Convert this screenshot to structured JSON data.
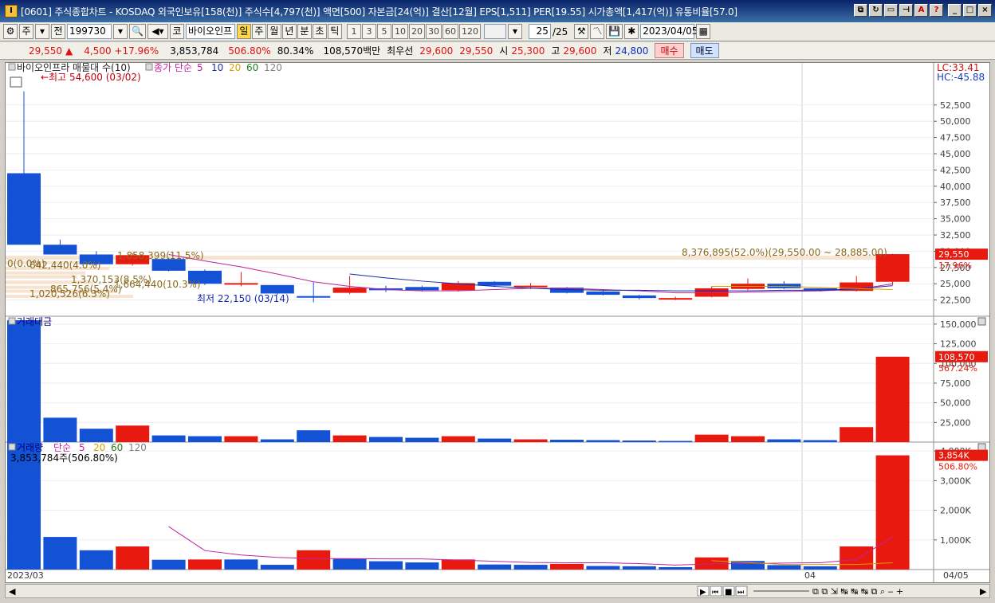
{
  "window": {
    "title": "[0601] 주식종합차트 - KOSDAQ 외국인보유[158(천)] 주식수[4,797(천)] 액면[500] 자본금[24(억)] 결산[12월] EPS[1,511] PER[19.55] 시가총액[1,417(억)] 유통비율[57.0]",
    "app_icon": "I"
  },
  "toolbar": {
    "period_type": "주",
    "prev_label": "전",
    "stock_code": "199730",
    "market_label": "코",
    "stock_name": "바이오인프",
    "intervals": [
      "일",
      "주",
      "월",
      "년",
      "분",
      "초",
      "틱"
    ],
    "selected_interval": "일",
    "minute_options": [
      "1",
      "3",
      "5",
      "10",
      "20",
      "30",
      "60",
      "120"
    ],
    "page_counter": "25",
    "page_total": "/25",
    "date": "2023/04/05"
  },
  "infobar": {
    "price": "29,550",
    "arrow": "▲",
    "change": "4,500 +17.96%",
    "volume": "3,853,784",
    "vol_ratio": "506.80%",
    "turnover": "80.34%",
    "amount": "108,570백만",
    "best_label": "최우선",
    "best_ask": "29,600",
    "best_bid": "29,550",
    "open_label": "시",
    "open": "25,300",
    "high_label": "고",
    "high": "29,600",
    "low_label": "저",
    "low": "24,800",
    "buy_label": "매수",
    "sell_label": "매도"
  },
  "chart_data": [
    {
      "type": "candlestick",
      "title": "바이오인프라 매물대 수(10)",
      "ma_label": "종가 단순",
      "ma_periods": [
        "5",
        "10",
        "20",
        "60",
        "120"
      ],
      "ylim": [
        20000,
        57500
      ],
      "yticks": [
        "52,500",
        "50,000",
        "47,500",
        "45,000",
        "42,500",
        "40,000",
        "37,500",
        "35,000",
        "32,500",
        "30,000",
        "27,500",
        "25,000",
        "22,500"
      ],
      "lc": "LC:33.41",
      "hc": "HC:-45.88",
      "current_price_label": "29,550",
      "current_pct_label": "17.96%",
      "high_annotation": "←최고 54,600 (03/02)",
      "low_annotation": "최저 22,150 (03/14)",
      "profile_annotation": "8,376,895(52.0%)(29,550.00 ~ 28,885.00)",
      "profile_labels": [
        "1,858,399(11.5%)",
        "1,370,153(8.5%)",
        "1,664,440(10.3%)",
        "865,756(5.4%)",
        "1,020,526(6.3%)",
        "0(0.0%)",
        "642,440(4.0%)"
      ],
      "candles": [
        {
          "o": 42000,
          "h": 54600,
          "l": 31000,
          "c": 31000
        },
        {
          "o": 31000,
          "h": 31800,
          "l": 29500,
          "c": 29500
        },
        {
          "o": 29500,
          "h": 30000,
          "l": 27800,
          "c": 28000
        },
        {
          "o": 28000,
          "h": 29700,
          "l": 27800,
          "c": 29400
        },
        {
          "o": 28800,
          "h": 29000,
          "l": 26900,
          "c": 27000
        },
        {
          "o": 27000,
          "h": 27200,
          "l": 24800,
          "c": 25000
        },
        {
          "o": 25000,
          "h": 26800,
          "l": 24600,
          "c": 25100
        },
        {
          "o": 24800,
          "h": 24800,
          "l": 23300,
          "c": 23500
        },
        {
          "o": 23100,
          "h": 25200,
          "l": 22150,
          "c": 23000
        },
        {
          "o": 23600,
          "h": 26200,
          "l": 23400,
          "c": 24400
        },
        {
          "o": 24300,
          "h": 24700,
          "l": 23700,
          "c": 24000
        },
        {
          "o": 24500,
          "h": 24700,
          "l": 23800,
          "c": 24000
        },
        {
          "o": 24000,
          "h": 25400,
          "l": 23800,
          "c": 25100
        },
        {
          "o": 25300,
          "h": 25400,
          "l": 24500,
          "c": 24700
        },
        {
          "o": 24500,
          "h": 25100,
          "l": 24200,
          "c": 24700
        },
        {
          "o": 24400,
          "h": 24500,
          "l": 23500,
          "c": 23600
        },
        {
          "o": 23800,
          "h": 24000,
          "l": 23200,
          "c": 23300
        },
        {
          "o": 23200,
          "h": 23300,
          "l": 22600,
          "c": 22800
        },
        {
          "o": 22800,
          "h": 23000,
          "l": 22500,
          "c": 22800
        },
        {
          "o": 23000,
          "h": 24600,
          "l": 22900,
          "c": 24300
        },
        {
          "o": 24200,
          "h": 25800,
          "l": 24000,
          "c": 25000
        },
        {
          "o": 25000,
          "h": 25400,
          "l": 24200,
          "c": 24300
        },
        {
          "o": 24300,
          "h": 24300,
          "l": 23800,
          "c": 24000
        },
        {
          "o": 23900,
          "h": 26200,
          "l": 23800,
          "c": 25200
        },
        {
          "o": 25300,
          "h": 29600,
          "l": 24800,
          "c": 29550
        }
      ],
      "ma5": [
        null,
        null,
        null,
        null,
        29500,
        28500,
        27600,
        26500,
        25300,
        24600,
        24100,
        23900,
        23900,
        24100,
        24300,
        24300,
        24100,
        23900,
        23600,
        23600,
        23700,
        23800,
        23900,
        24100,
        25000
      ],
      "ma10": [
        null,
        null,
        null,
        null,
        null,
        null,
        null,
        null,
        null,
        26500,
        25900,
        25400,
        25000,
        24600,
        24300,
        24100,
        24000,
        24000,
        23900,
        23900,
        23900,
        24000,
        24000,
        24200,
        24700
      ]
    },
    {
      "type": "bar",
      "title": "거래대금",
      "ylim": [
        0,
        160000
      ],
      "yticks": [
        "150,000",
        "125,000",
        "100,000",
        "75,000",
        "50,000",
        "25,000"
      ],
      "current_label": "108,570",
      "current_pct_label": "567.24%",
      "values": [
        155000,
        31000,
        17000,
        21000,
        8500,
        7500,
        7500,
        3500,
        15000,
        8500,
        6500,
        5500,
        7500,
        4500,
        3500,
        3000,
        2500,
        2000,
        1500,
        9500,
        7500,
        3500,
        2500,
        19000,
        108570
      ],
      "up": [
        false,
        false,
        false,
        true,
        false,
        false,
        true,
        false,
        false,
        true,
        false,
        false,
        true,
        false,
        true,
        false,
        false,
        false,
        false,
        true,
        true,
        false,
        false,
        true,
        true
      ]
    },
    {
      "type": "bar",
      "title": "거래량",
      "ma_label": "단순",
      "ma_periods": [
        "5",
        "20",
        "60",
        "120"
      ],
      "annotation": "3,853,784주(506.80%)",
      "ylim": [
        0,
        4300000
      ],
      "yticks": [
        "4,000K",
        "3,000K",
        "2,000K",
        "1,000K"
      ],
      "current_label": "3,854K",
      "current_pct_label": "506.80%",
      "x_labels": [
        "2023/03",
        "04",
        "04/05"
      ],
      "values": [
        4300000,
        1100000,
        650000,
        780000,
        330000,
        340000,
        340000,
        160000,
        650000,
        360000,
        280000,
        240000,
        340000,
        170000,
        160000,
        190000,
        120000,
        110000,
        80000,
        410000,
        290000,
        150000,
        110000,
        780000,
        3853784
      ],
      "up": [
        false,
        false,
        false,
        true,
        false,
        true,
        false,
        false,
        true,
        false,
        false,
        false,
        true,
        false,
        false,
        true,
        false,
        false,
        false,
        true,
        false,
        false,
        false,
        true,
        true
      ],
      "ma5": [
        null,
        null,
        null,
        null,
        1450000,
        640000,
        490000,
        410000,
        370000,
        370000,
        360000,
        360000,
        320000,
        280000,
        240000,
        230000,
        230000,
        200000,
        150000,
        190000,
        200000,
        220000,
        230000,
        340000,
        1100000
      ]
    }
  ],
  "colors": {
    "up": "#e8190e",
    "down": "#1352d4",
    "ma5": "#c0249c",
    "ma10": "#1a2aa8",
    "ma20": "#d8a000",
    "profile": "#f7e4d0"
  }
}
